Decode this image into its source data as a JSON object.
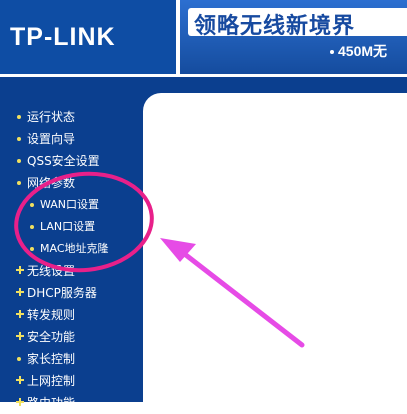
{
  "header": {
    "logo": "TP-LINK",
    "slogan": "领略无线新境界",
    "subslogan": "450M无"
  },
  "sidebar": {
    "items": [
      {
        "label": "运行状态",
        "type": "item"
      },
      {
        "label": "设置向导",
        "type": "item"
      },
      {
        "label": "QSS安全设置",
        "type": "item"
      },
      {
        "label": "网络参数",
        "type": "item"
      },
      {
        "label": "WAN口设置",
        "type": "sub"
      },
      {
        "label": "LAN口设置",
        "type": "sub"
      },
      {
        "label": "MAC地址克隆",
        "type": "sub"
      },
      {
        "label": "无线设置",
        "type": "plus"
      },
      {
        "label": "DHCP服务器",
        "type": "plus"
      },
      {
        "label": "转发规则",
        "type": "plus"
      },
      {
        "label": "安全功能",
        "type": "plus"
      },
      {
        "label": "家长控制",
        "type": "item"
      },
      {
        "label": "上网控制",
        "type": "plus"
      },
      {
        "label": "路由功能",
        "type": "plus"
      }
    ]
  },
  "colors": {
    "sidebar_bg": "#0b3f8f",
    "annotation": "#e8208a",
    "arrow": "#e64be6"
  },
  "icons": {
    "bullet": "dot-icon",
    "expand": "plus-icon",
    "arrow": "arrow-icon"
  }
}
